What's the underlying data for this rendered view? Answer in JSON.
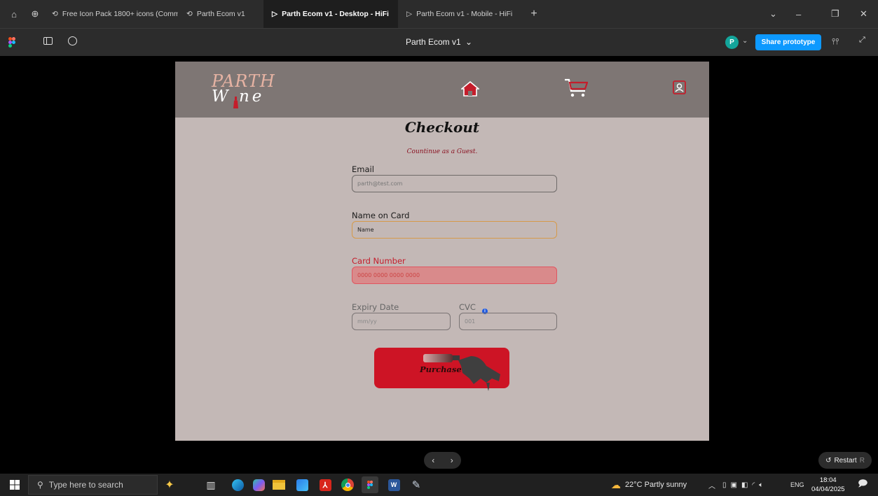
{
  "browser": {
    "tabs": [
      {
        "label": "Free Icon Pack 1800+ icons (Commu",
        "active": false
      },
      {
        "label": "Parth Ecom v1",
        "active": false
      },
      {
        "label": "Parth Ecom v1 - Desktop - HiFi",
        "active": true
      },
      {
        "label": "Parth Ecom v1 - Mobile - HiFi",
        "active": false
      }
    ],
    "new_tab": "+"
  },
  "figma": {
    "doc_title": "Parth Ecom v1",
    "avatar_initial": "P",
    "share_label": "Share prototype"
  },
  "site": {
    "logo_top": "PARTH",
    "logo_bottom": "W ne",
    "colors": {
      "header": "#7e7674",
      "body": "#c3b8b6",
      "accent": "#cd1425"
    }
  },
  "checkout": {
    "title": "Checkout",
    "guest_link": "Countinue as a Guest.",
    "email_label": "Email",
    "email_placeholder": "parth@test.com",
    "name_label": "Name on Card",
    "name_value": "Name",
    "card_label": "Card Number",
    "card_placeholder": "0000 0000 0000 0000",
    "expiry_label": "Expiry Date",
    "expiry_placeholder": "mm/yy",
    "cvc_label": "CVC",
    "cvc_placeholder": "001",
    "purchase_label": "Purchase"
  },
  "prototype": {
    "prev": "‹",
    "next": "›",
    "restart_label": "Restart",
    "restart_key": "R"
  },
  "taskbar": {
    "search_placeholder": "Type here to search",
    "weather": "22°C  Partly sunny",
    "lang": "ENG",
    "time": "18:04",
    "date": "04/04/2025"
  }
}
